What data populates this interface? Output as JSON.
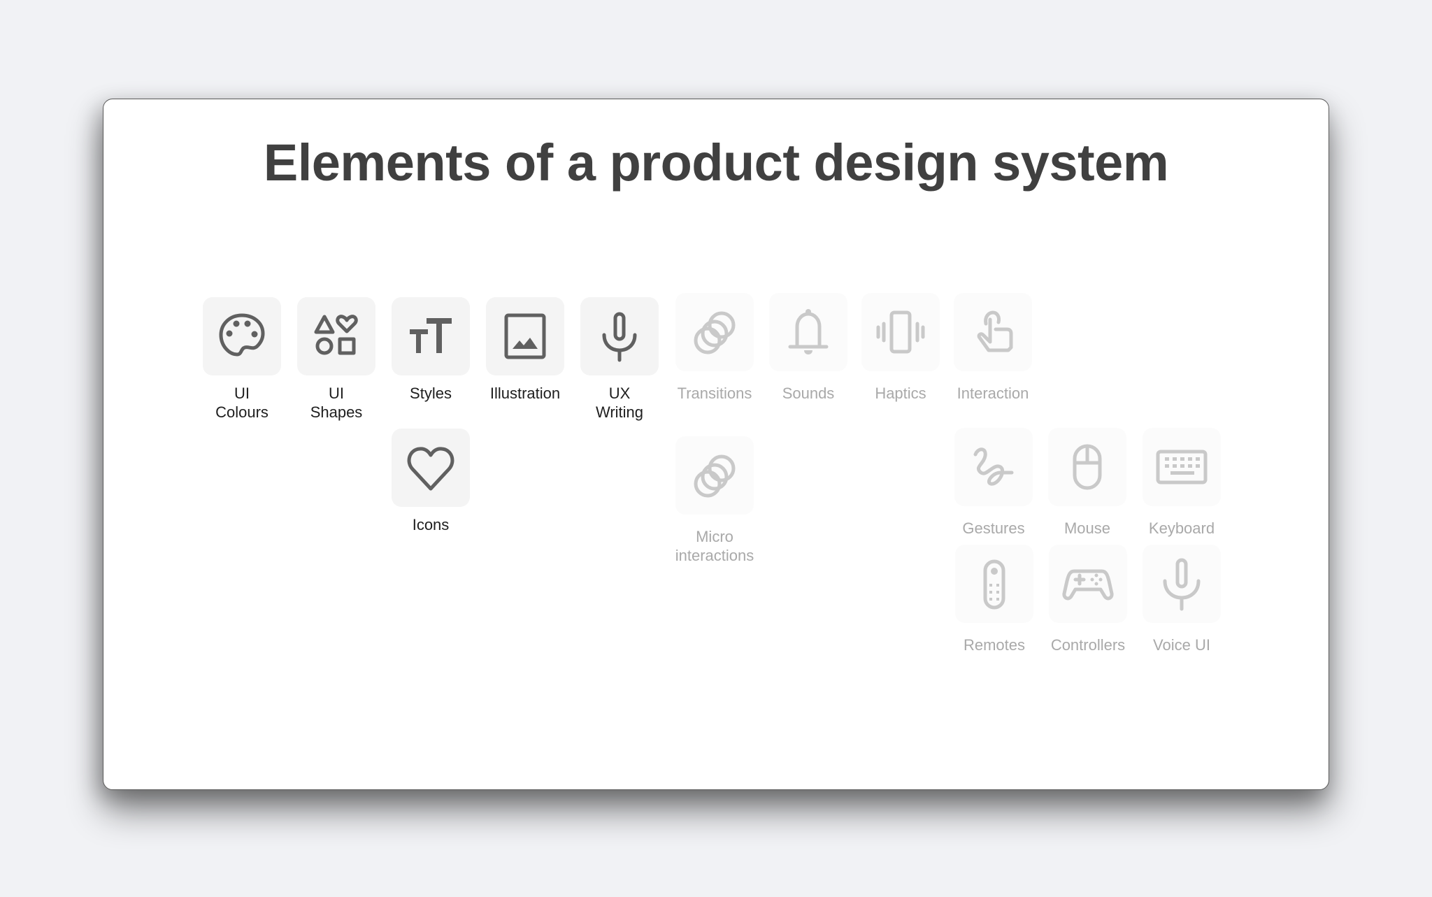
{
  "slide": {
    "title": "Elements of a product design system"
  },
  "colors": {
    "background": "#f1f2f5",
    "slide": "#ffffff",
    "title_text": "#404040",
    "active_icon": "#606060",
    "faded_icon": "#c9c9c9",
    "active_label": "#1e1e1e",
    "faded_label": "#a9a9a9"
  },
  "items": {
    "ui_colours": {
      "label_line1": "UI",
      "label_line2": "Colours",
      "icon": "palette-icon",
      "state": "active"
    },
    "ui_shapes": {
      "label_line1": "UI",
      "label_line2": "Shapes",
      "icon": "shapes-icon",
      "state": "active"
    },
    "styles": {
      "label": "Styles",
      "icon": "text-size-icon",
      "state": "active"
    },
    "illustration": {
      "label": "Illustration",
      "icon": "image-icon",
      "state": "active"
    },
    "ux_writing": {
      "label_line1": "UX",
      "label_line2": "Writing",
      "icon": "microphone-icon",
      "state": "active"
    },
    "icons": {
      "label": "Icons",
      "icon": "heart-icon",
      "state": "active"
    },
    "transitions": {
      "label": "Transitions",
      "icon": "overlapping-circles-icon",
      "state": "faded"
    },
    "sounds": {
      "label": "Sounds",
      "icon": "bell-icon",
      "state": "faded"
    },
    "haptics": {
      "label": "Haptics",
      "icon": "vibrate-icon",
      "state": "faded"
    },
    "interaction": {
      "label": "Interaction",
      "icon": "tap-hand-icon",
      "state": "faded"
    },
    "micro_interactions": {
      "label_line1": "Micro",
      "label_line2": "interactions",
      "icon": "overlapping-circles-icon",
      "state": "faded"
    },
    "gestures": {
      "label": "Gestures",
      "icon": "squiggle-icon",
      "state": "faded"
    },
    "mouse": {
      "label": "Mouse",
      "icon": "mouse-icon",
      "state": "faded"
    },
    "keyboard": {
      "label": "Keyboard",
      "icon": "keyboard-icon",
      "state": "faded"
    },
    "remotes": {
      "label": "Remotes",
      "icon": "remote-icon",
      "state": "faded"
    },
    "controllers": {
      "label": "Controllers",
      "icon": "gamepad-icon",
      "state": "faded"
    },
    "voice_ui": {
      "label": "Voice UI",
      "icon": "microphone-icon",
      "state": "faded"
    }
  }
}
